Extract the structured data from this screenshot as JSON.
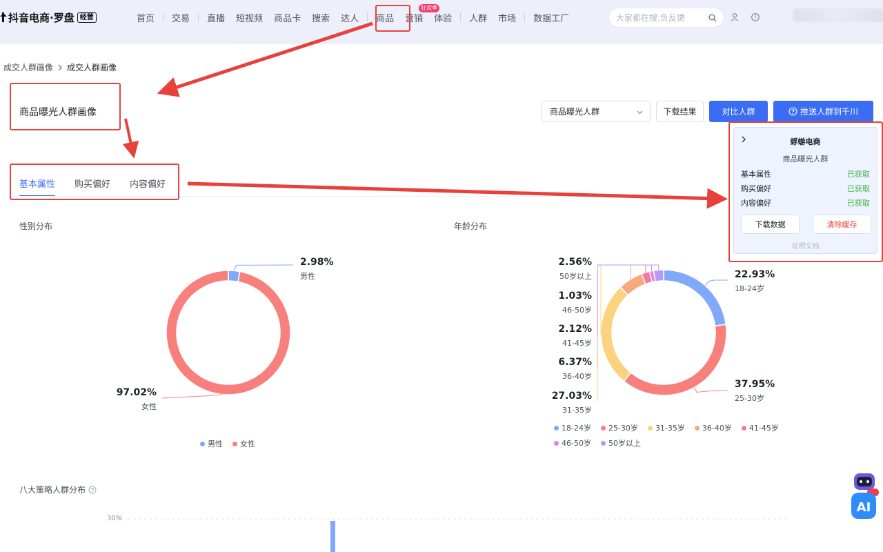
{
  "header": {
    "logo_text": "抖音电商·罗盘",
    "logo_badge": "经营",
    "nav": [
      "首页",
      "交易",
      "直播",
      "短视频",
      "商品卡",
      "搜索",
      "达人",
      "商品",
      "营销",
      "体验",
      "人群",
      "市场",
      "数据工厂"
    ],
    "hot_badge": "狂欢季",
    "search_placeholder": "大家都在搜:负反馈"
  },
  "breadcrumb": [
    "成交人群画像",
    "成交人群画像"
  ],
  "page_title": "商品曝光人群画像",
  "toolbar": {
    "select_value": "商品曝光人群",
    "download_label": "下载结果",
    "compare_label": "对比人群",
    "push_label": "推送人群到千川"
  },
  "tabs": [
    "基本属性",
    "购买偏好",
    "内容偏好"
  ],
  "popup": {
    "brand": "蜉蝣电商",
    "subtitle": "商品曝光人群",
    "rows": [
      {
        "label": "基本属性",
        "status": "已获取"
      },
      {
        "label": "购买偏好",
        "status": "已获取"
      },
      {
        "label": "内容偏好",
        "status": "已获取"
      }
    ],
    "download_data": "下载数据",
    "clear_cache": "清除缓存",
    "doc_link": "说明文档"
  },
  "gender_title": "性别分布",
  "age_title": "年龄分布",
  "strategy_title": "八大策略人群分布",
  "strategy_axis_tick": "30%",
  "colors": {
    "accent": "#3a6cf4",
    "blue": "#82a8fb",
    "red": "#f8807c",
    "yellow": "#fbd27d",
    "orange": "#f7a87e",
    "pink": "#f27ba0",
    "magenta": "#e07ef0",
    "purple": "#b39bf5",
    "ok_green": "#3fb548",
    "danger_red": "#e8413b"
  },
  "chart_data": [
    {
      "type": "pie",
      "title": "性别分布",
      "series": [
        {
          "name": "男性",
          "value": 2.98,
          "label": "2.98%",
          "color": "#82a8fb"
        },
        {
          "name": "女性",
          "value": 97.02,
          "label": "97.02%",
          "color": "#f8807c"
        }
      ],
      "legend": [
        "男性",
        "女性"
      ],
      "legend_position": "bottom"
    },
    {
      "type": "pie",
      "title": "年龄分布",
      "series": [
        {
          "name": "18-24岁",
          "value": 22.93,
          "label": "22.93%",
          "color": "#82a8fb"
        },
        {
          "name": "25-30岁",
          "value": 37.95,
          "label": "37.95%",
          "color": "#f8807c"
        },
        {
          "name": "31-35岁",
          "value": 27.03,
          "label": "27.03%",
          "color": "#fbd27d"
        },
        {
          "name": "36-40岁",
          "value": 6.37,
          "label": "6.37%",
          "color": "#f7a87e"
        },
        {
          "name": "41-45岁",
          "value": 2.12,
          "label": "2.12%",
          "color": "#f27ba0"
        },
        {
          "name": "46-50岁",
          "value": 1.03,
          "label": "1.03%",
          "color": "#e07ef0"
        },
        {
          "name": "50岁以上",
          "value": 2.56,
          "label": "2.56%",
          "color": "#b39bf5"
        }
      ],
      "legend": [
        "18-24岁",
        "25-30岁",
        "31-35岁",
        "36-40岁",
        "41-45岁",
        "46-50岁",
        "50岁以上"
      ],
      "legend_position": "bottom"
    }
  ]
}
